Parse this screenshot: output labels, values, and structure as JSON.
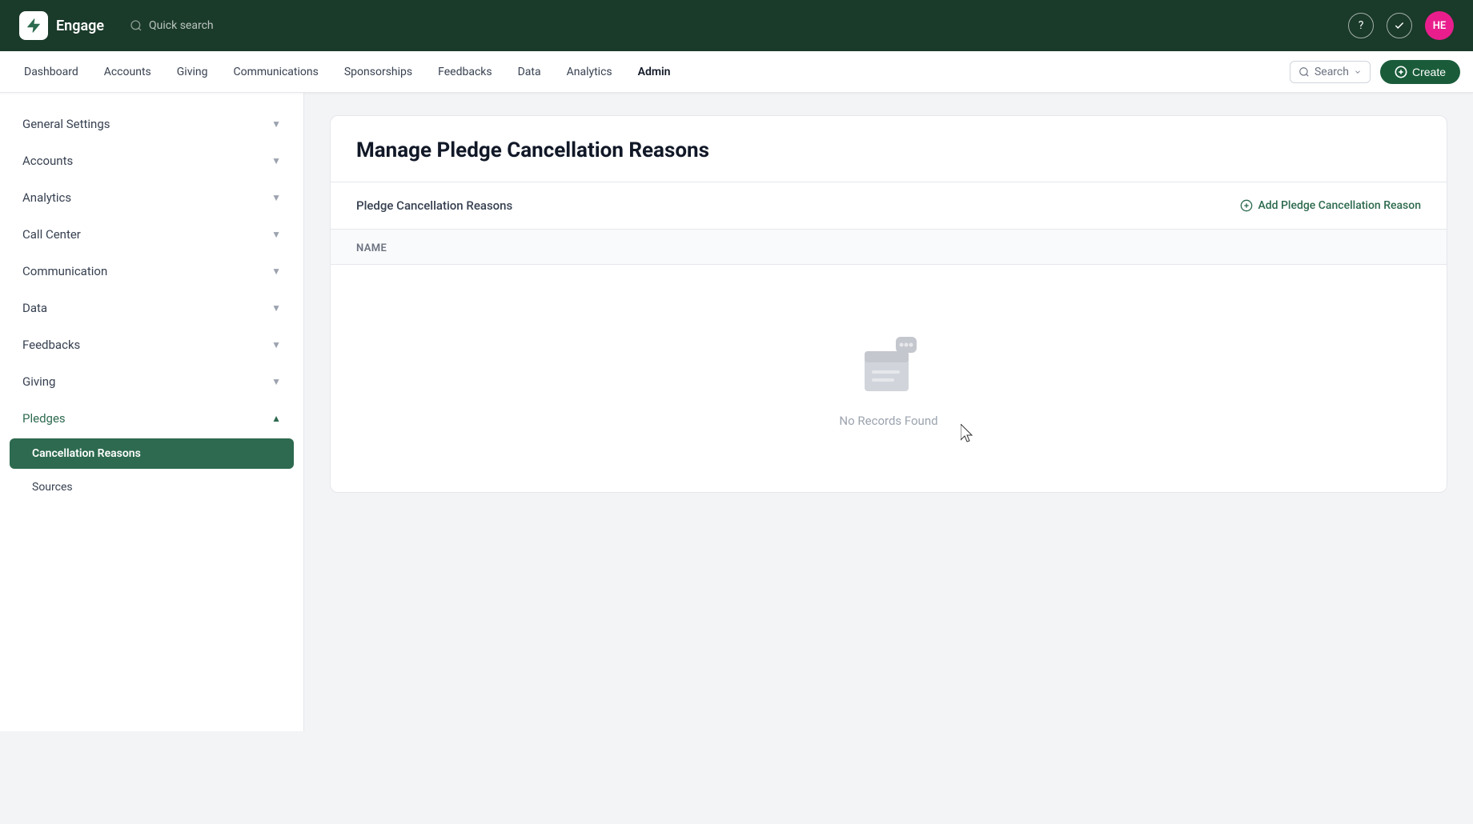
{
  "app": {
    "name": "Engage",
    "logo_alt": "Engage logo"
  },
  "topbar": {
    "quick_search": "Quick search",
    "avatar_initials": "HE",
    "avatar_bg": "#e91e8c"
  },
  "secondary_nav": {
    "items": [
      {
        "id": "dashboard",
        "label": "Dashboard",
        "active": false
      },
      {
        "id": "accounts",
        "label": "Accounts",
        "active": false
      },
      {
        "id": "giving",
        "label": "Giving",
        "active": false
      },
      {
        "id": "communications",
        "label": "Communications",
        "active": false
      },
      {
        "id": "sponsorships",
        "label": "Sponsorships",
        "active": false
      },
      {
        "id": "feedbacks",
        "label": "Feedbacks",
        "active": false
      },
      {
        "id": "data",
        "label": "Data",
        "active": false
      },
      {
        "id": "analytics",
        "label": "Analytics",
        "active": false
      },
      {
        "id": "admin",
        "label": "Admin",
        "active": true
      }
    ],
    "search_placeholder": "Search",
    "create_label": "Create"
  },
  "sidebar": {
    "items": [
      {
        "id": "general-settings",
        "label": "General Settings",
        "expanded": false,
        "active": false
      },
      {
        "id": "accounts",
        "label": "Accounts",
        "expanded": false,
        "active": false
      },
      {
        "id": "analytics",
        "label": "Analytics",
        "expanded": false,
        "active": false
      },
      {
        "id": "call-center",
        "label": "Call Center",
        "expanded": false,
        "active": false
      },
      {
        "id": "communication",
        "label": "Communication",
        "expanded": false,
        "active": false
      },
      {
        "id": "data",
        "label": "Data",
        "expanded": false,
        "active": false
      },
      {
        "id": "feedbacks",
        "label": "Feedbacks",
        "expanded": false,
        "active": false
      },
      {
        "id": "giving",
        "label": "Giving",
        "expanded": false,
        "active": false
      },
      {
        "id": "pledges",
        "label": "Pledges",
        "expanded": true,
        "active": false
      }
    ],
    "pledges_sub_items": [
      {
        "id": "cancellation-reasons",
        "label": "Cancellation Reasons",
        "active": true
      },
      {
        "id": "sources",
        "label": "Sources",
        "active": false
      }
    ]
  },
  "main": {
    "page_title": "Manage Pledge Cancellation Reasons",
    "section_label": "Pledge Cancellation Reasons",
    "add_btn_label": "Add Pledge Cancellation Reason",
    "table_column_name": "Name",
    "empty_state_text": "No Records Found"
  }
}
